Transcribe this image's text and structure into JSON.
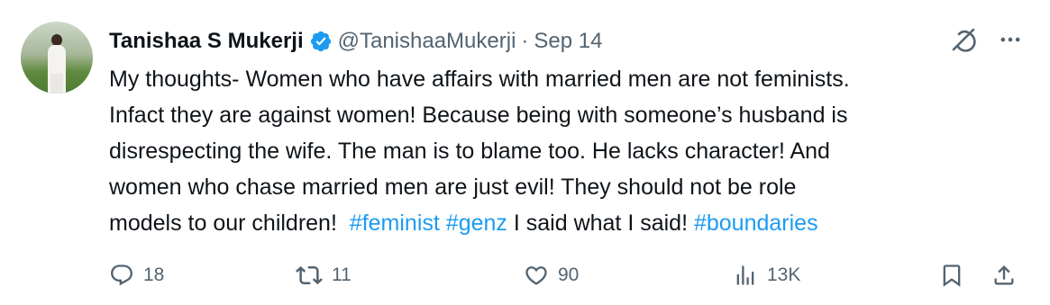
{
  "tweet": {
    "author": {
      "name": "Tanishaa S Mukerji",
      "handle": "@TanishaaMukerji",
      "separator": "·",
      "date": "Sep 14",
      "verified_color": "#1d9bf0"
    },
    "text": {
      "line1": "My thoughts-  Women who have affairs with married men are not feminists.",
      "line2": "Infact they are against women! Because being with someone’s husband is",
      "line3": "disrespecting the wife. The man is to blame too. He lacks character! And",
      "line4": "women who chase married men are just evil! They should not be role",
      "line5_start": "models to our children!  ",
      "hashtag1": "#feminist",
      "space": " ",
      "hashtag2": "#genz",
      "line5_mid": " I said what I said! ",
      "hashtag3": "#boundaries"
    },
    "metrics": {
      "replies": "18",
      "retweets": "11",
      "likes": "90",
      "views": "13K"
    },
    "icons": {
      "grok": "grok-icon",
      "more": "more-icon",
      "reply": "reply-icon",
      "retweet": "retweet-icon",
      "like": "heart-icon",
      "views": "views-icon",
      "bookmark": "bookmark-icon",
      "share": "share-icon"
    },
    "colors": {
      "hashtag": "#1d9bf0",
      "secondary_text": "#536471"
    }
  }
}
